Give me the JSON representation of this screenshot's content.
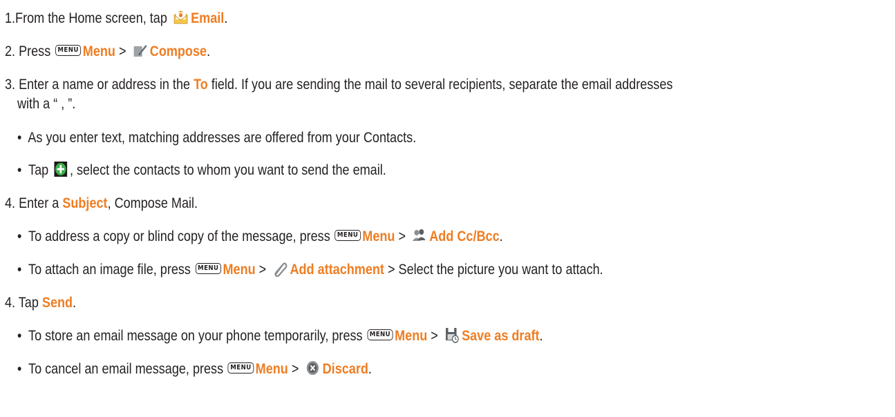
{
  "steps": {
    "s1": {
      "prefix": "1.From the Home screen, tap ",
      "email": "Email",
      "end": "."
    },
    "s2": {
      "prefix": "2. Press ",
      "key": "MENU",
      "menu": "Menu",
      "gt": " > ",
      "compose": "Compose",
      "end": "."
    },
    "s3a": {
      "prefix": "3. Enter a name or address in the ",
      "to": "To",
      "rest": " field. If you are sending the mail to several recipients, separate the email addresses"
    },
    "s3b": {
      "text": "with a “ , ”."
    },
    "b1": {
      "bullet": "•",
      "text": "As you enter text, matching addresses are offered from your Contacts."
    },
    "b2": {
      "bullet": "•",
      "prefix": "Tap ",
      "rest": ", select the contacts to whom you want to send the email."
    },
    "s4": {
      "prefix": "4. Enter a ",
      "subject": "Subject",
      "rest": ", Compose Mail."
    },
    "b3": {
      "bullet": "•",
      "prefix": "To address a copy or blind copy of the message, press ",
      "key": "MENU",
      "menu": "Menu",
      "gt": " > ",
      "label": "Add Cc/Bcc",
      "end": "."
    },
    "b4": {
      "bullet": "•",
      "prefix": "To attach an image file, press ",
      "key": "MENU",
      "menu": "Menu",
      "gt": " > ",
      "label": "Add attachment",
      "rest": " > Select the picture you want to attach."
    },
    "s5": {
      "prefix": "4. Tap ",
      "send": "Send",
      "end": "."
    },
    "b5": {
      "bullet": "•",
      "prefix": "To store an email message on your phone temporarily, press ",
      "key": "MENU",
      "menu": "Menu",
      "gt": " > ",
      "label": "Save as draft",
      "end": "."
    },
    "b6": {
      "bullet": "•",
      "prefix": "To cancel an email message, press ",
      "key": "MENU",
      "menu": "Menu",
      "gt": " > ",
      "label": "Discard",
      "end": "."
    }
  },
  "icons": {
    "email": "email-app-icon",
    "compose": "compose-icon",
    "add_contact": "add-contact-plus-icon",
    "cc_bcc": "contacts-people-icon",
    "attachment": "paperclip-icon",
    "save_draft": "save-draft-disk-icon",
    "discard": "discard-x-icon"
  },
  "colors": {
    "highlight": "#ef7d22",
    "text": "#231f20"
  }
}
